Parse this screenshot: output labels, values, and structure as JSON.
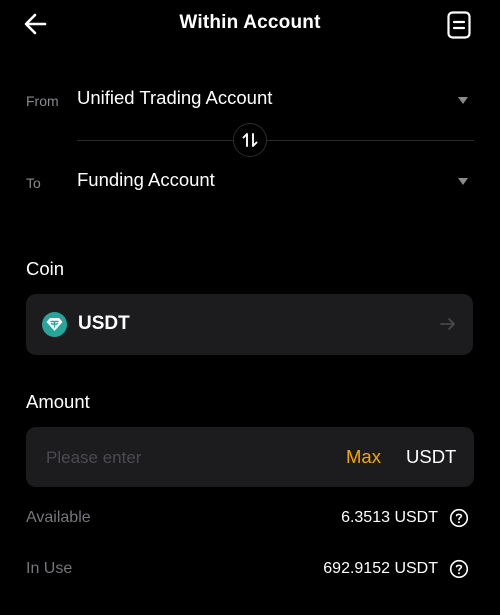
{
  "header": {
    "title": "Within Account",
    "back_icon": "arrow-left-icon",
    "record_icon": "document-list-icon"
  },
  "from": {
    "label": "From",
    "account": "Unified Trading Account"
  },
  "to": {
    "label": "To",
    "account": "Funding Account"
  },
  "swap_icon": "swap-vertical-icon",
  "coin": {
    "label": "Coin",
    "name": "USDT",
    "icon": "tether-icon",
    "icon_color": "#26a69a"
  },
  "amount": {
    "label": "Amount",
    "placeholder": "Please enter",
    "value": "",
    "max_label": "Max",
    "unit": "USDT"
  },
  "balances": {
    "available_label": "Available",
    "available_value": "6.3513 USDT",
    "in_use_label": "In Use",
    "in_use_value": "692.9152 USDT"
  },
  "colors": {
    "background": "#000000",
    "panel": "#1c1c1f",
    "accent": "#f7a600",
    "muted_text": "#8a8a8f"
  }
}
